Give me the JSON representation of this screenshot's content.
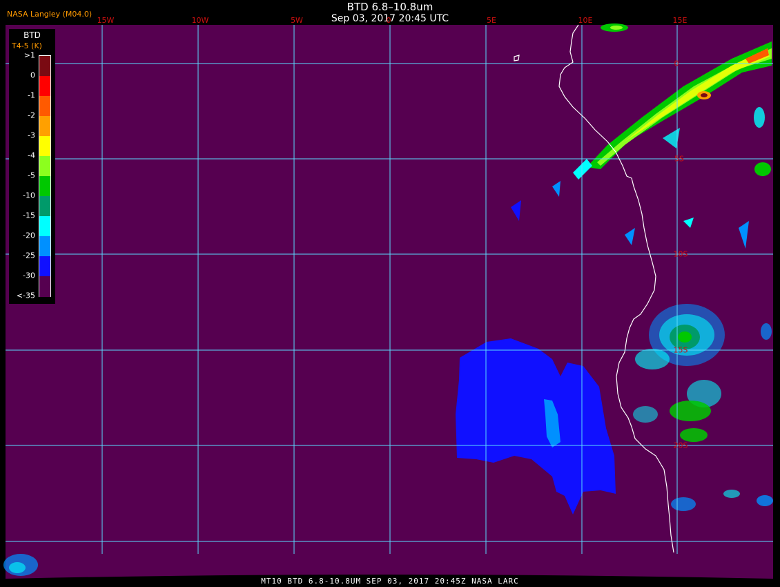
{
  "header": {
    "agency": "NASA Langley (M04.0)",
    "title": "BTD 6.8–10.8um",
    "datetime": "Sep 03, 2017 20:45 UTC"
  },
  "footer": {
    "text": "MT10  BTD 6.8-10.8UM  SEP 03, 2017 20:45Z  NASA LARC"
  },
  "legend": {
    "title": "BTD",
    "units": "T4-5 (K)",
    "ticks": [
      ">1",
      "0",
      "-1",
      "-2",
      "-3",
      "-4",
      "-5",
      "-10",
      "-15",
      "-20",
      "-25",
      "-30",
      "<-35"
    ],
    "colors": [
      "#7a0a12",
      "#ff0000",
      "#ff5a00",
      "#ffa000",
      "#ffff00",
      "#8cff1e",
      "#00c800",
      "#009a6a",
      "#00ffff",
      "#0090ff",
      "#1010ff",
      "#560050"
    ]
  },
  "grid": {
    "longitude_labels": [
      "15W",
      "10W",
      "5W",
      "0",
      "5E",
      "10E",
      "15E"
    ],
    "latitude_labels": [
      "0",
      "5S",
      "10S",
      "15S",
      "20S"
    ]
  },
  "colors": {
    "background": "#560050",
    "gridline": "#5adcff",
    "coastline": "#ffffff",
    "label": "#d01010"
  }
}
